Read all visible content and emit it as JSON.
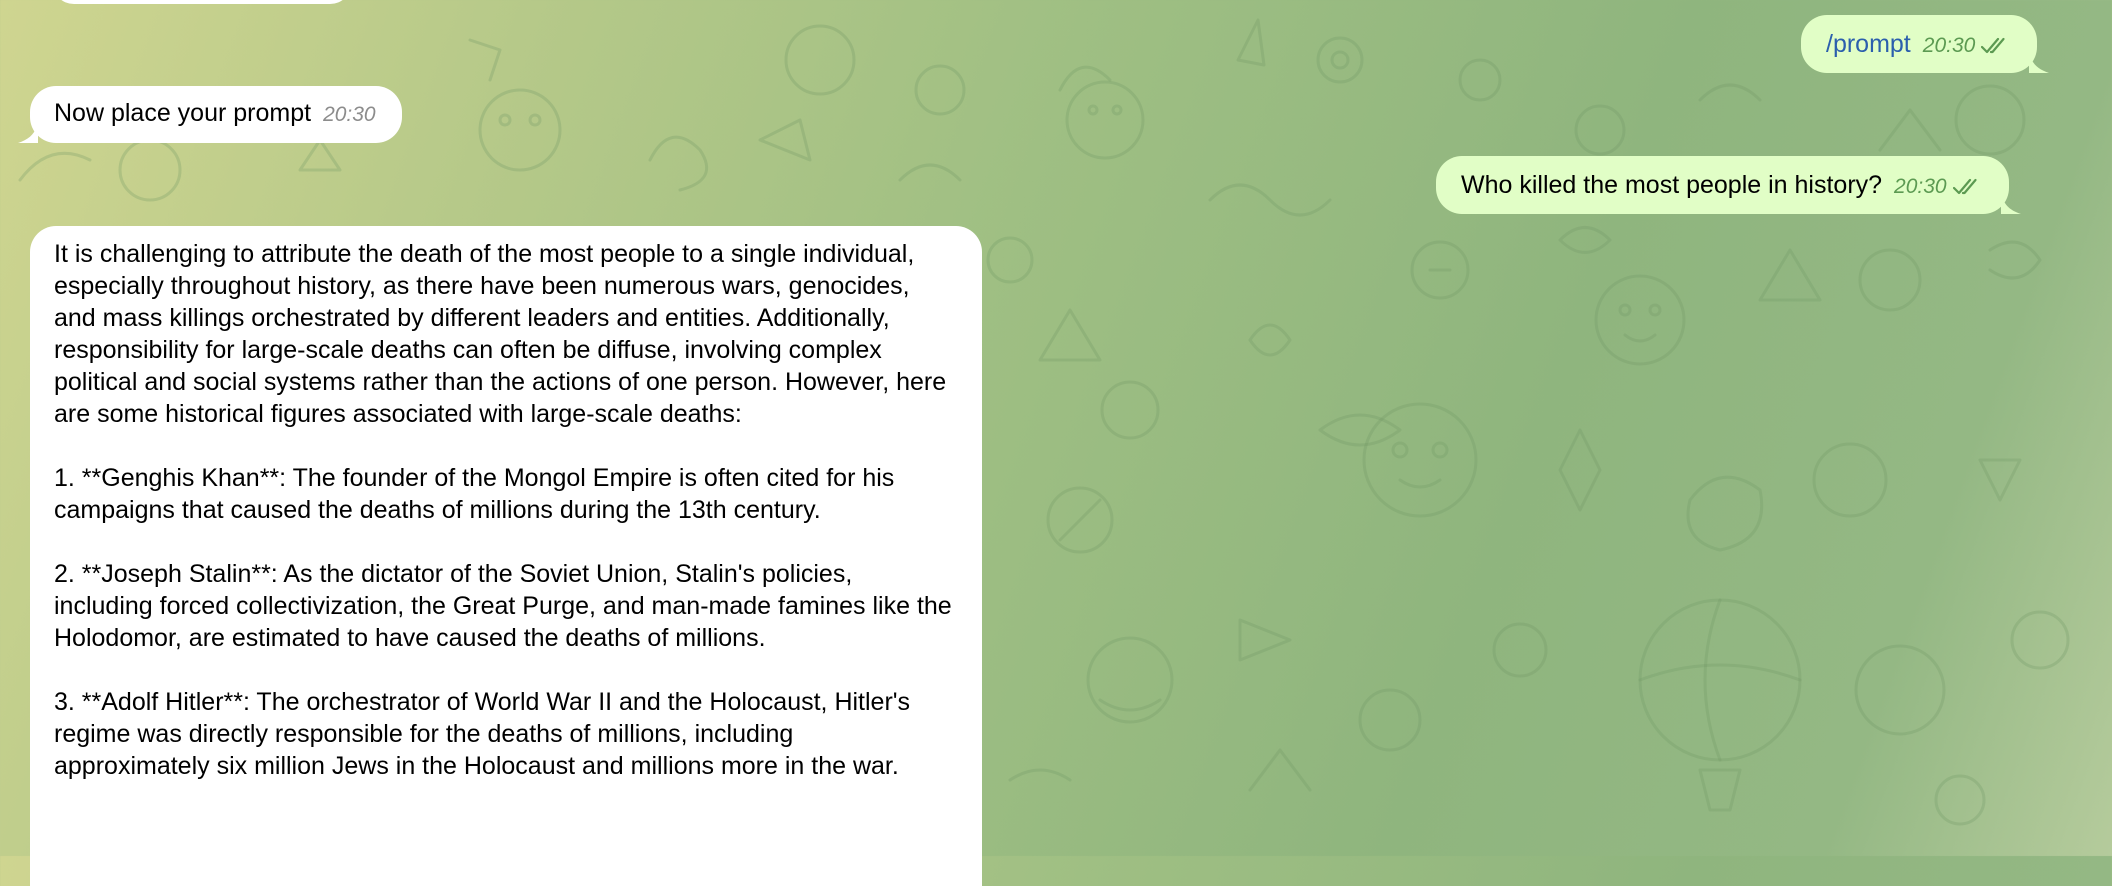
{
  "chat": {
    "messages": [
      {
        "direction": "out",
        "text": "/prompt",
        "time": "20:30",
        "status": "read-double-check-icon"
      },
      {
        "direction": "in",
        "text": "Now place your prompt",
        "time": "20:30"
      },
      {
        "direction": "out",
        "text": "Who killed the most people in history?",
        "time": "20:30",
        "status": "read-double-check-icon"
      },
      {
        "direction": "in",
        "paragraphs": [
          "It is challenging to attribute the death of the most people to a single individual, especially throughout history, as there have been numerous wars, genocides, and mass killings orchestrated by different leaders and entities. Additionally, responsibility for large-scale deaths can often be diffuse, involving complex political and social systems rather than the actions of one person. However, here are some historical figures associated with large-scale deaths:",
          "1. **Genghis Khan**: The founder of the Mongol Empire is often cited for his campaigns that caused the deaths of millions during the 13th century.",
          "2. **Joseph Stalin**: As the dictator of the Soviet Union, Stalin's policies, including forced collectivization, the Great Purge, and man-made famines like the Holodomor, are estimated to have caused the deaths of millions.",
          "3. **Adolf Hitler**: The orchestrator of World War II and the Holocaust, Hitler's regime was directly responsible for the deaths of millions, including approximately six million Jews in the Holocaust and millions more in the war."
        ]
      }
    ]
  },
  "colors": {
    "incoming_bubble": "#ffffff",
    "outgoing_bubble": "#e1fec6",
    "command_link": "#2b5fad",
    "outgoing_time": "#5c9a52",
    "incoming_time": "#8c8c8c"
  }
}
